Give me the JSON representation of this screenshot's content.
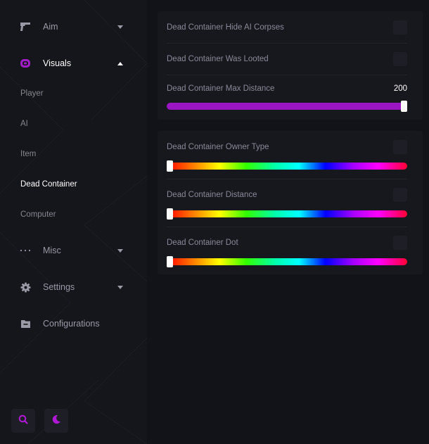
{
  "sidebar": {
    "nav": [
      {
        "label": "Aim",
        "icon": "gun-icon"
      },
      {
        "label": "Visuals",
        "icon": "eye-icon"
      },
      {
        "label": "Misc",
        "icon": "more-dots-icon"
      },
      {
        "label": "Settings",
        "icon": "gear-icon"
      },
      {
        "label": "Configurations",
        "icon": "folder-icon"
      }
    ],
    "visuals_sub": [
      "Player",
      "AI",
      "Item",
      "Dead Container",
      "Computer"
    ],
    "active_sub": "Dead Container",
    "accent": "#a21cc7"
  },
  "panel1": {
    "hide_ai_corpses": {
      "label": "Dead Container Hide AI Corpses",
      "checked": false
    },
    "was_looted": {
      "label": "Dead Container Was Looted",
      "checked": false
    },
    "max_distance": {
      "label": "Dead Container Max Distance",
      "value": "200",
      "fraction": 1.0,
      "color": "#9b15c2"
    }
  },
  "panel2": {
    "owner_type": {
      "label": "Dead Container Owner Type",
      "checked": false,
      "hue_fraction": 0.0
    },
    "distance": {
      "label": "Dead Container Distance",
      "checked": false,
      "hue_fraction": 0.0
    },
    "dot": {
      "label": "Dead Container Dot",
      "checked": false,
      "hue_fraction": 0.0
    }
  }
}
